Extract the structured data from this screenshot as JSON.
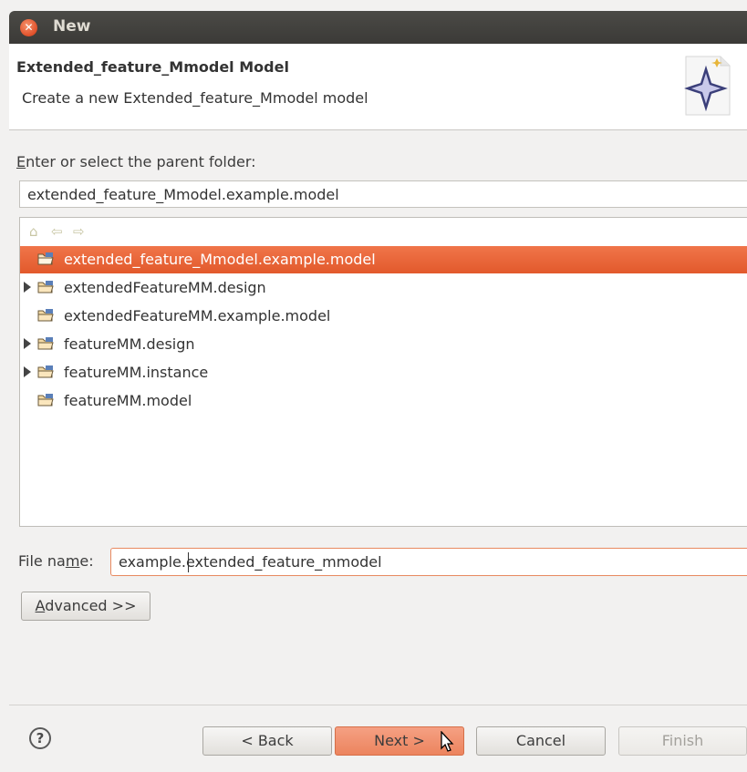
{
  "window": {
    "title": "New"
  },
  "header": {
    "title": "Extended_feature_Mmodel Model",
    "description": "Create a new Extended_feature_Mmodel model"
  },
  "folder": {
    "label_prefix": "",
    "label_mnemonic": "E",
    "label_rest": "nter or select the parent folder:",
    "value": "extended_feature_Mmodel.example.model"
  },
  "nav_icons": [
    "home-icon",
    "back-arrow-icon",
    "forward-arrow-icon"
  ],
  "tree": {
    "items": [
      {
        "label": "extended_feature_Mmodel.example.model",
        "expandable": false,
        "selected": true
      },
      {
        "label": "extendedFeatureMM.design",
        "expandable": true,
        "selected": false
      },
      {
        "label": "extendedFeatureMM.example.model",
        "expandable": false,
        "selected": false
      },
      {
        "label": "featureMM.design",
        "expandable": true,
        "selected": false
      },
      {
        "label": "featureMM.instance",
        "expandable": true,
        "selected": false
      },
      {
        "label": "featureMM.model",
        "expandable": false,
        "selected": false
      }
    ]
  },
  "file": {
    "label_prefix": "File na",
    "label_mnemonic": "m",
    "label_rest": "e:",
    "value": "example.extended_feature_mmodel"
  },
  "advanced": {
    "mnemonic": "A",
    "rest": "dvanced >>"
  },
  "footer": {
    "help": "?",
    "back": "< Back",
    "next": "Next >",
    "cancel": "Cancel",
    "finish": "Finish"
  },
  "colors": {
    "selection": "#e8643a",
    "primary_button": "#ef8c67",
    "titlebar": "#3f3e3a"
  }
}
